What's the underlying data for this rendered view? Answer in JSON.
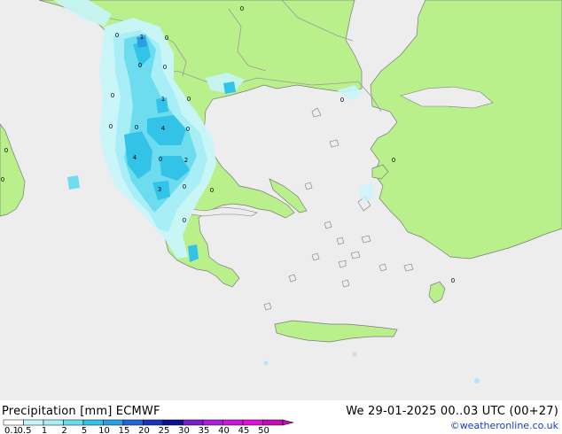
{
  "footer": {
    "title": "Precipitation [mm]  ECMWF",
    "timestamp": "We 29-01-2025 00..03 UTC (00+27)",
    "credit": "©weatheronline.co.uk"
  },
  "legend": {
    "ticks": [
      "0.1",
      "0.5",
      "1",
      "2",
      "5",
      "10",
      "15",
      "20",
      "25",
      "30",
      "35",
      "40",
      "45",
      "50"
    ],
    "colors": [
      "#ffffff",
      "#c8f5fa",
      "#a8eef6",
      "#6ddcef",
      "#33c3e8",
      "#2b9fe0",
      "#2464d6",
      "#1a34b6",
      "#0a148c",
      "#7a1ec8",
      "#a820d8",
      "#c818d8",
      "#e010d8",
      "#c010b0"
    ]
  },
  "colors": {
    "sea": "#ededed",
    "land": "#b9f08c",
    "border": "#9a9a9a",
    "coast": "#7a7a7a"
  },
  "map_labels": [
    "0",
    "0",
    "1",
    "0",
    "0",
    "0",
    "0",
    "0",
    "1",
    "0",
    "0",
    "4",
    "0",
    "0",
    "0",
    "4",
    "0",
    "2",
    "3",
    "0",
    "0",
    "0",
    "0",
    "0",
    "0"
  ]
}
